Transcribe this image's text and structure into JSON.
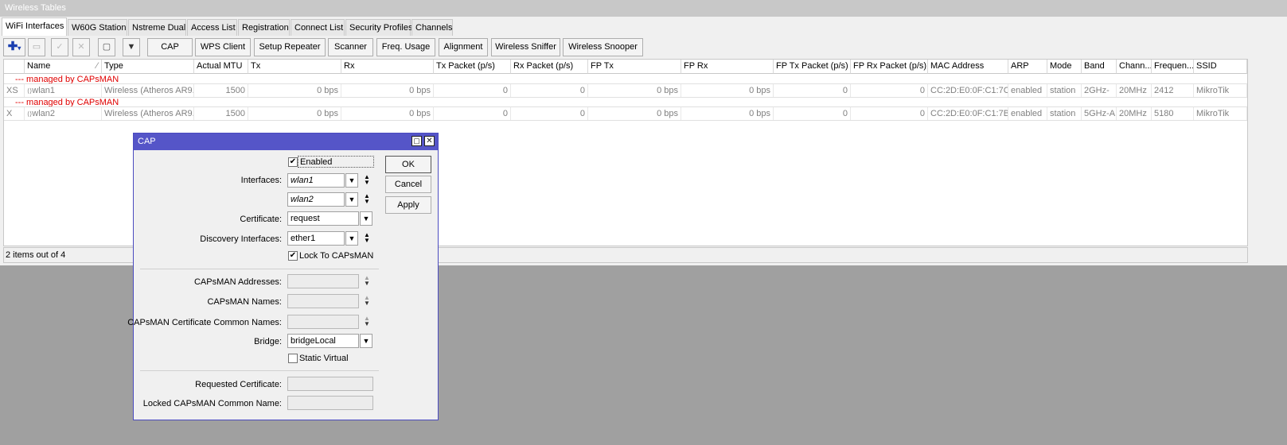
{
  "window": {
    "title": "Wireless Tables"
  },
  "tabs": [
    "WiFi Interfaces",
    "W60G Station",
    "Nstreme Dual",
    "Access List",
    "Registration",
    "Connect List",
    "Security Profiles",
    "Channels"
  ],
  "toolbar": {
    "buttons": [
      "CAP",
      "WPS Client",
      "Setup Repeater",
      "Scanner",
      "Freq. Usage",
      "Alignment",
      "Wireless Sniffer",
      "Wireless Snooper"
    ],
    "icons": [
      "add-icon",
      "remove-icon",
      "enable-icon",
      "disable-icon",
      "comment-icon",
      "filter-icon"
    ]
  },
  "table": {
    "columns": [
      "",
      "Name",
      "Type",
      "Actual MTU",
      "Tx",
      "Rx",
      "Tx Packet (p/s)",
      "Rx Packet (p/s)",
      "FP Tx",
      "FP Rx",
      "FP Tx Packet (p/s)",
      "FP Rx Packet (p/s)",
      "MAC Address",
      "ARP",
      "Mode",
      "Band",
      "Chann...",
      "Frequen...",
      "SSID"
    ],
    "rows": [
      {
        "group": "--- managed by CAPsMAN",
        "cells": [
          "XS",
          "wlan1",
          "Wireless (Atheros AR9...",
          "1500",
          "0 bps",
          "0 bps",
          "0",
          "0",
          "0 bps",
          "0 bps",
          "0",
          "0",
          "CC:2D:E0:0F:C1:7C",
          "enabled",
          "station",
          "2GHz-",
          "20MHz",
          "2412",
          "MikroTik"
        ]
      },
      {
        "group": "--- managed by CAPsMAN",
        "cells": [
          "X",
          "wlan2",
          "Wireless (Atheros AR9...",
          "1500",
          "0 bps",
          "0 bps",
          "0",
          "0",
          "0 bps",
          "0 bps",
          "0",
          "0",
          "CC:2D:E0:0F:C1:7B",
          "enabled",
          "station",
          "5GHz-A",
          "20MHz",
          "5180",
          "MikroTik"
        ]
      }
    ]
  },
  "status": "2 items out of 4",
  "dialog": {
    "title": "CAP",
    "enabled": {
      "label": "Enabled",
      "checked": true
    },
    "interfaces_label": "Interfaces:",
    "interfaces": [
      "wlan1",
      "wlan2"
    ],
    "certificate_label": "Certificate:",
    "certificate": "request",
    "discovery_label": "Discovery Interfaces:",
    "discovery": "ether1",
    "lock": {
      "label": "Lock To CAPsMAN",
      "checked": true
    },
    "addresses_label": "CAPsMAN Addresses:",
    "names_label": "CAPsMAN Names:",
    "cert_names_label": "CAPsMAN Certificate Common Names:",
    "bridge_label": "Bridge:",
    "bridge": "bridgeLocal",
    "static_virtual": {
      "label": "Static Virtual",
      "checked": false
    },
    "requested_cert_label": "Requested Certificate:",
    "locked_name_label": "Locked CAPsMAN Common Name:",
    "ok": "OK",
    "cancel": "Cancel",
    "apply": "Apply"
  }
}
